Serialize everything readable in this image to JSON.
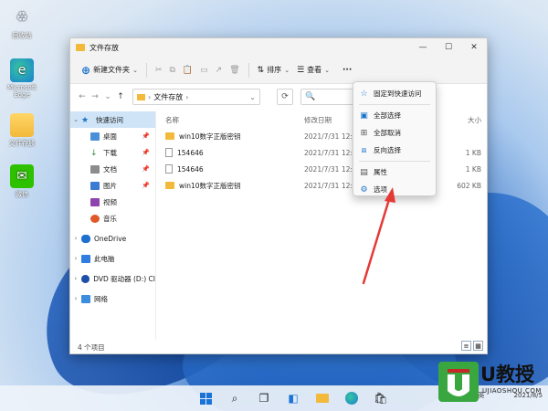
{
  "desktop": {
    "icons": [
      {
        "label": "回收站",
        "icon": "recycle-bin-icon"
      },
      {
        "label": "Microsoft Edge",
        "icon": "edge-icon"
      },
      {
        "label": "文件存放",
        "icon": "folder-icon"
      },
      {
        "label": "微信",
        "icon": "wechat-icon"
      }
    ]
  },
  "window": {
    "title": "文件存放",
    "controls": {
      "minimize": "—",
      "maximize": "☐",
      "close": "✕"
    }
  },
  "toolbar": {
    "new_label": "新建文件夹",
    "sort_label": "排序",
    "view_label": "查看",
    "more": "···"
  },
  "address": {
    "path": "文件存放",
    "search_icon": "🔍"
  },
  "sidebar": {
    "items": [
      {
        "label": "快速访问",
        "icon": "star-icon"
      },
      {
        "label": "桌面",
        "icon": "desktop-icon"
      },
      {
        "label": "下载",
        "icon": "download-icon"
      },
      {
        "label": "文档",
        "icon": "document-icon"
      },
      {
        "label": "图片",
        "icon": "picture-icon"
      },
      {
        "label": "视频",
        "icon": "video-icon"
      },
      {
        "label": "音乐",
        "icon": "music-icon"
      },
      {
        "label": "OneDrive",
        "icon": "cloud-icon"
      },
      {
        "label": "此电脑",
        "icon": "computer-icon"
      },
      {
        "label": "DVD 驱动器 (D:) CI",
        "icon": "dvd-icon"
      },
      {
        "label": "网络",
        "icon": "network-icon"
      }
    ]
  },
  "files": {
    "headers": {
      "name": "名称",
      "date": "修改日期",
      "size": "大小"
    },
    "rows": [
      {
        "name": "win10数字正版密钥",
        "date": "2021/7/31 12:16",
        "size": "",
        "type": "folder"
      },
      {
        "name": "154646",
        "date": "2021/7/31 12:1",
        "size": "1 KB",
        "type": "doc"
      },
      {
        "name": "154646",
        "date": "2021/7/31 12:0",
        "size": "1 KB",
        "type": "doc"
      },
      {
        "name": "win10数字正版密钥",
        "date": "2021/7/31 12:16",
        "size": "602 KB",
        "type": "folder"
      }
    ]
  },
  "status": {
    "count": "4 个项目"
  },
  "menu": {
    "items": [
      {
        "label": "固定到快速访问",
        "icon": "pin-star-icon"
      },
      {
        "label": "全部选择",
        "icon": "select-all-icon"
      },
      {
        "label": "全部取消",
        "icon": "select-none-icon"
      },
      {
        "label": "反向选择",
        "icon": "invert-selection-icon"
      },
      {
        "label": "属性",
        "icon": "properties-icon"
      },
      {
        "label": "选项",
        "icon": "options-icon"
      }
    ]
  },
  "taskbar": {
    "ime": "英",
    "date": "2021/8/5"
  },
  "watermark": {
    "brand": "U教授",
    "site": "UJIAOSHOU.COM"
  },
  "colors": {
    "accent": "#1a73c9",
    "arrow": "#e53935",
    "selection": "#cfe4f7"
  }
}
